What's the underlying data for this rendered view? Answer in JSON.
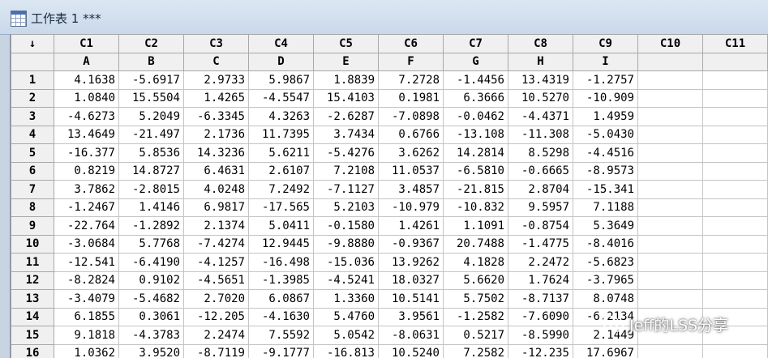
{
  "window": {
    "title": "工作表 1 ***"
  },
  "sheet": {
    "corner_symbol": "↓",
    "columns": [
      "C1",
      "C2",
      "C3",
      "C4",
      "C5",
      "C6",
      "C7",
      "C8",
      "C9",
      "C10",
      "C11"
    ],
    "names": [
      "A",
      "B",
      "C",
      "D",
      "E",
      "F",
      "G",
      "H",
      "I",
      "",
      ""
    ],
    "rows": [
      {
        "n": "1",
        "v": [
          "4.1638",
          "-5.6917",
          "2.9733",
          "5.9867",
          "1.8839",
          "7.2728",
          "-1.4456",
          "13.4319",
          "-1.2757"
        ]
      },
      {
        "n": "2",
        "v": [
          "1.0840",
          "15.5504",
          "1.4265",
          "-4.5547",
          "15.4103",
          "0.1981",
          "6.3666",
          "10.5270",
          "-10.909"
        ]
      },
      {
        "n": "3",
        "v": [
          "-4.6273",
          "5.2049",
          "-6.3345",
          "4.3263",
          "-2.6287",
          "-7.0898",
          "-0.0462",
          "-4.4371",
          "1.4959"
        ]
      },
      {
        "n": "4",
        "v": [
          "13.4649",
          "-21.497",
          "2.1736",
          "11.7395",
          "3.7434",
          "0.6766",
          "-13.108",
          "-11.308",
          "-5.0430"
        ]
      },
      {
        "n": "5",
        "v": [
          "-16.377",
          "5.8536",
          "14.3236",
          "5.6211",
          "-5.4276",
          "3.6262",
          "14.2814",
          "8.5298",
          "-4.4516"
        ]
      },
      {
        "n": "6",
        "v": [
          "0.8219",
          "14.8727",
          "6.4631",
          "2.6107",
          "7.2108",
          "11.0537",
          "-6.5810",
          "-0.6665",
          "-8.9573"
        ]
      },
      {
        "n": "7",
        "v": [
          "3.7862",
          "-2.8015",
          "4.0248",
          "7.2492",
          "-7.1127",
          "3.4857",
          "-21.815",
          "2.8704",
          "-15.341"
        ]
      },
      {
        "n": "8",
        "v": [
          "-1.2467",
          "1.4146",
          "6.9817",
          "-17.565",
          "5.2103",
          "-10.979",
          "-10.832",
          "9.5957",
          "7.1188"
        ]
      },
      {
        "n": "9",
        "v": [
          "-22.764",
          "-1.2892",
          "2.1374",
          "5.0411",
          "-0.1580",
          "1.4261",
          "1.1091",
          "-0.8754",
          "5.3649"
        ]
      },
      {
        "n": "10",
        "v": [
          "-3.0684",
          "5.7768",
          "-7.4274",
          "12.9445",
          "-9.8880",
          "-0.9367",
          "20.7488",
          "-1.4775",
          "-8.4016"
        ]
      },
      {
        "n": "11",
        "v": [
          "-12.541",
          "-6.4190",
          "-4.1257",
          "-16.498",
          "-15.036",
          "13.9262",
          "4.1828",
          "2.2472",
          "-5.6823"
        ]
      },
      {
        "n": "12",
        "v": [
          "-8.2824",
          "0.9102",
          "-4.5651",
          "-1.3985",
          "-4.5241",
          "18.0327",
          "5.6620",
          "1.7624",
          "-3.7965"
        ]
      },
      {
        "n": "13",
        "v": [
          "-3.4079",
          "-5.4682",
          "2.7020",
          "6.0867",
          "1.3360",
          "10.5141",
          "5.7502",
          "-8.7137",
          "8.0748"
        ]
      },
      {
        "n": "14",
        "v": [
          "6.1855",
          "0.3061",
          "-12.205",
          "-4.1630",
          "5.4760",
          "3.9561",
          "-1.2582",
          "-7.6090",
          "-6.2134"
        ]
      },
      {
        "n": "15",
        "v": [
          "9.1818",
          "-4.3783",
          "2.2474",
          "7.5592",
          "5.0542",
          "-8.0631",
          "0.5217",
          "-8.5990",
          "2.1449"
        ]
      },
      {
        "n": "16",
        "v": [
          "1.0362",
          "3.9520",
          "-8.7119",
          "-9.1777",
          "-16.813",
          "10.5240",
          "7.2582",
          "-12.235",
          "17.6967"
        ]
      }
    ]
  },
  "watermark": {
    "text": "Jeff的LSS分享"
  },
  "colors": {
    "header_bg": "#f0f0f0",
    "grid": "#c4c4c4",
    "window_bg": "#c8d4e2"
  }
}
